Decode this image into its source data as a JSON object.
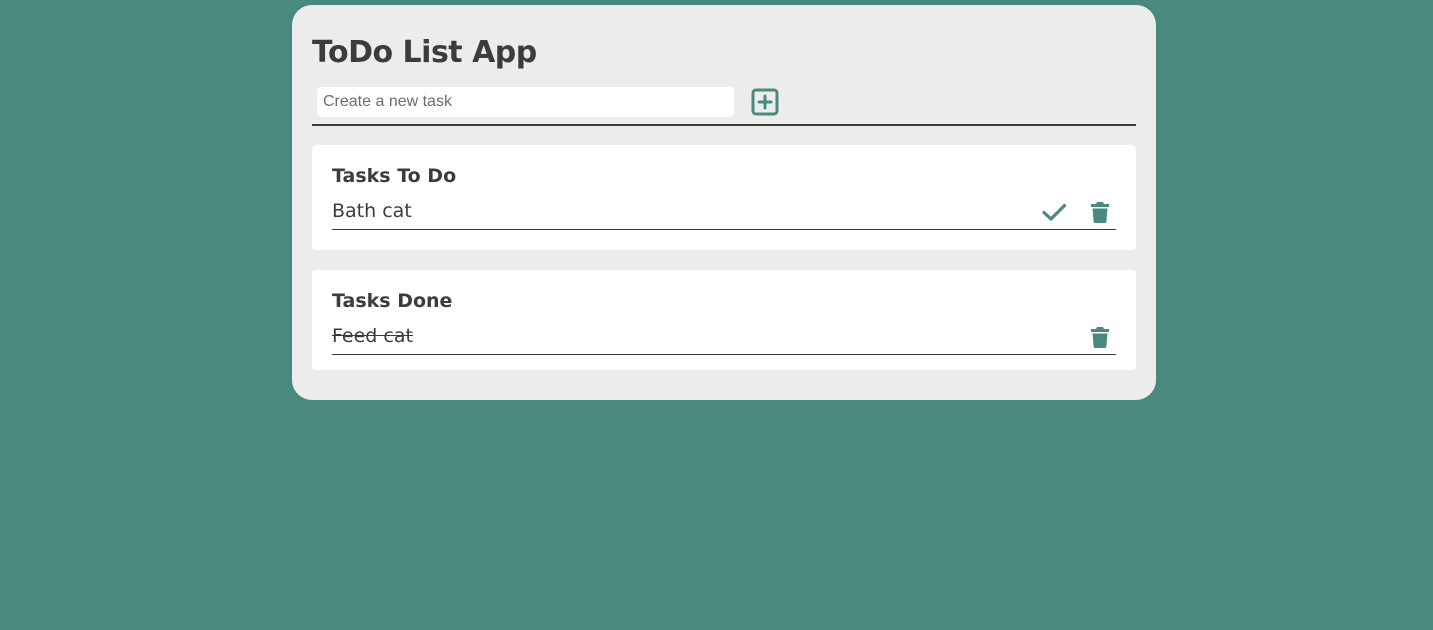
{
  "app": {
    "title": "ToDo List App"
  },
  "new_task": {
    "placeholder": "Create a new task",
    "value": "",
    "add_icon": "plus-square-icon"
  },
  "todo_section": {
    "title": "Tasks To Do",
    "tasks": [
      {
        "text": "Bath cat",
        "complete_icon": "checkmark-icon",
        "delete_icon": "trash-icon"
      }
    ]
  },
  "done_section": {
    "title": "Tasks Done",
    "tasks": [
      {
        "text": "Feed cat",
        "delete_icon": "trash-icon"
      }
    ]
  },
  "colors": {
    "background": "#4a8a7e",
    "panel": "#ececec",
    "card": "#ffffff",
    "text": "#3c3c3c",
    "accent": "#4a8a7e"
  }
}
